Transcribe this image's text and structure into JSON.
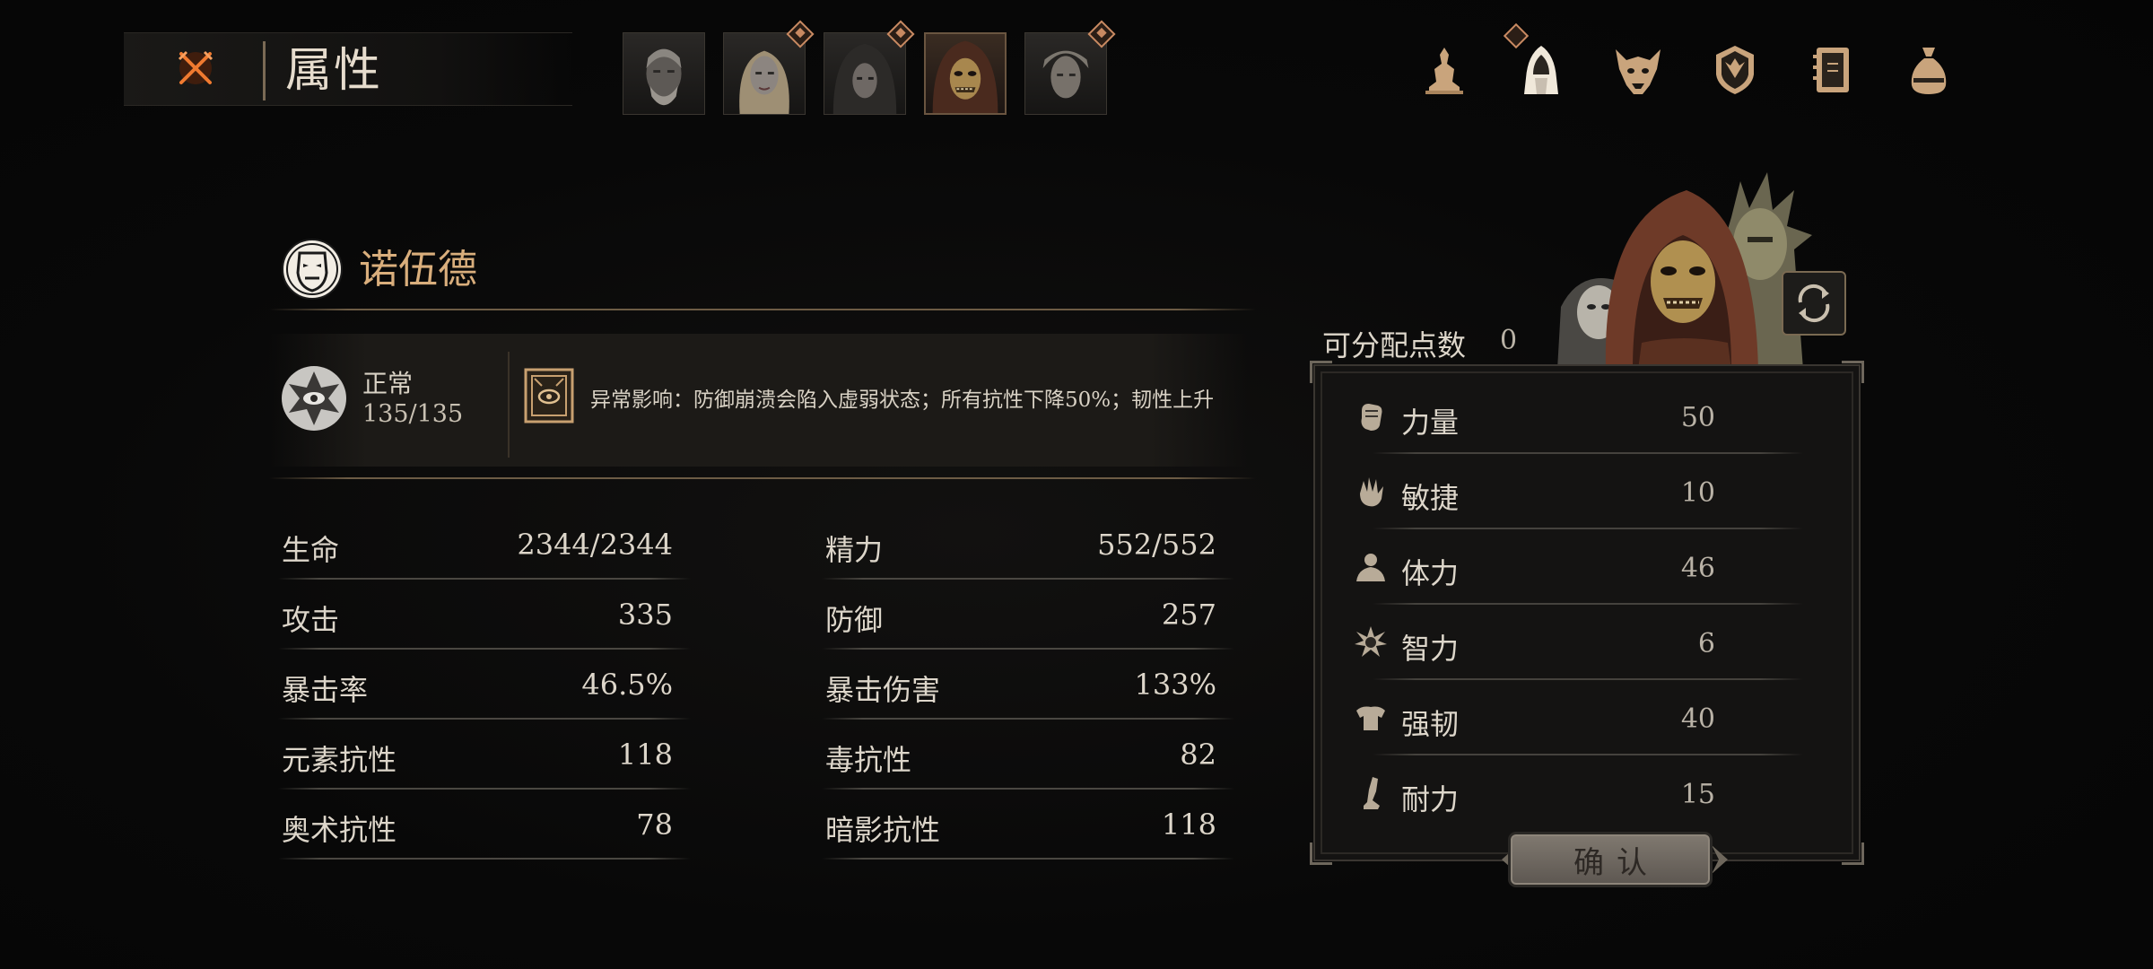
{
  "header": {
    "title": "属性",
    "close_icon": "crossed-swords-close-icon",
    "portraits": [
      {
        "name": "portrait-old-man",
        "badge": false,
        "active": false
      },
      {
        "name": "portrait-blonde-woman",
        "badge": true,
        "active": false
      },
      {
        "name": "portrait-hooded-woman",
        "badge": true,
        "active": false
      },
      {
        "name": "portrait-masked-hooded",
        "badge": false,
        "active": true
      },
      {
        "name": "portrait-pale-man",
        "badge": true,
        "active": false
      }
    ],
    "tabs": [
      {
        "icon": "statue-icon",
        "badge": false
      },
      {
        "icon": "hooded-figure-icon",
        "badge": true
      },
      {
        "icon": "demon-mask-icon",
        "badge": false
      },
      {
        "icon": "shield-emblem-icon",
        "badge": false
      },
      {
        "icon": "journal-icon",
        "badge": false
      },
      {
        "icon": "coin-bag-icon",
        "badge": false
      }
    ]
  },
  "character": {
    "name": "诺伍德",
    "status": {
      "name": "正常",
      "value": "135/135",
      "effect": "异常影响：防御崩溃会陷入虚弱状态；所有抗性下降50%；韧性上升"
    }
  },
  "stats": [
    {
      "left": {
        "label": "生命",
        "value": "2344/2344"
      },
      "right": {
        "label": "精力",
        "value": "552/552"
      }
    },
    {
      "left": {
        "label": "攻击",
        "value": "335"
      },
      "right": {
        "label": "防御",
        "value": "257"
      }
    },
    {
      "left": {
        "label": "暴击率",
        "value": "46.5%"
      },
      "right": {
        "label": "暴击伤害",
        "value": "133%"
      }
    },
    {
      "left": {
        "label": "元素抗性",
        "value": "118"
      },
      "right": {
        "label": "毒抗性",
        "value": "82"
      }
    },
    {
      "left": {
        "label": "奥术抗性",
        "value": "78"
      },
      "right": {
        "label": "暗影抗性",
        "value": "118"
      }
    }
  ],
  "allocation": {
    "points_label": "可分配点数",
    "points_value": "0",
    "attributes": [
      {
        "label": "力量",
        "value": "50",
        "icon": "fist-icon"
      },
      {
        "label": "敏捷",
        "value": "10",
        "icon": "hand-icon"
      },
      {
        "label": "体力",
        "value": "46",
        "icon": "torso-icon"
      },
      {
        "label": "智力",
        "value": "6",
        "icon": "burst-icon"
      },
      {
        "label": "强韧",
        "value": "40",
        "icon": "armor-icon"
      },
      {
        "label": "耐力",
        "value": "15",
        "icon": "leg-icon"
      }
    ],
    "confirm_label": "确认"
  },
  "colors": {
    "accent_gold": "#d9ae7c",
    "badge_orange": "#c98a62",
    "close_orange": "#e0702a"
  }
}
